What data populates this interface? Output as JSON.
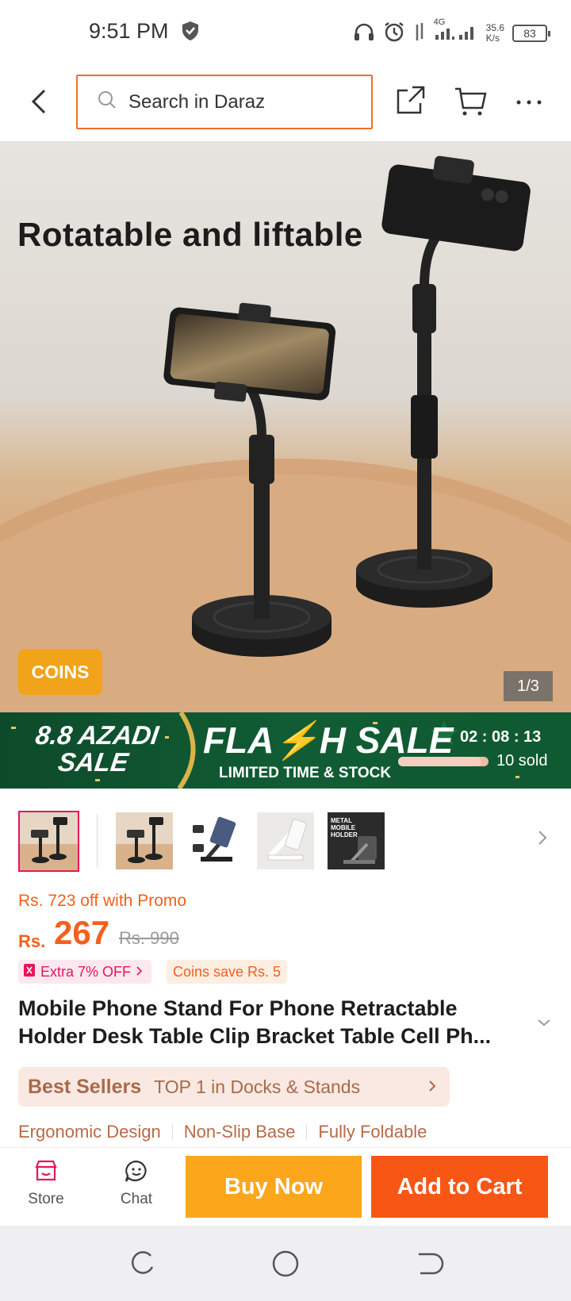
{
  "status_bar": {
    "time": "9:51 PM",
    "network_type": "4G",
    "speed_value": "35.6",
    "speed_unit": "K/s",
    "battery": "83"
  },
  "header": {
    "search_placeholder": "Search in Daraz"
  },
  "hero": {
    "headline": "Rotatable and liftable",
    "coins_badge": "COINS",
    "image_counter": "1/3"
  },
  "flash_banner": {
    "event_line1": "8.8 AZADI",
    "event_line2": "SALE",
    "title": "FLA⚡H SALE",
    "subtitle": "LIMITED TIME & STOCK",
    "timer": "02 : 08 : 13",
    "sold_text": "10 sold",
    "sold_progress": 0.92
  },
  "thumbnails": {
    "items": [
      {
        "caption": "Rotatable and liftable"
      },
      {
        "caption": "Rotatable and liftable"
      },
      {
        "caption": ""
      },
      {
        "caption": ""
      },
      {
        "caption": "METAL MOBILE HOLDER"
      }
    ]
  },
  "pricing": {
    "promo_text": "Rs. 723 off with Promo",
    "currency": "Rs.",
    "price": "267",
    "original_price": "Rs. 990",
    "extra_off": "Extra 7% OFF",
    "coins_save": "Coins save Rs. 5"
  },
  "product": {
    "title_line1": "Mobile Phone Stand For Phone Retractable",
    "title_line2": "Holder Desk Table Clip Bracket Table Cell Ph..."
  },
  "best_sellers": {
    "label": "Best Sellers",
    "rank_text": "TOP 1 in Docks & Stands"
  },
  "features": [
    "Ergonomic Design",
    "Non-Slip Base",
    "Fully Foldable"
  ],
  "action_bar": {
    "store_label": "Store",
    "chat_label": "Chat",
    "buy_now_label": "Buy Now",
    "add_to_cart_label": "Add to Cart"
  },
  "colors": {
    "accent_orange": "#f85614",
    "buy_now": "#fba61b",
    "promo": "#f3601d",
    "pink": "#e8145e"
  }
}
